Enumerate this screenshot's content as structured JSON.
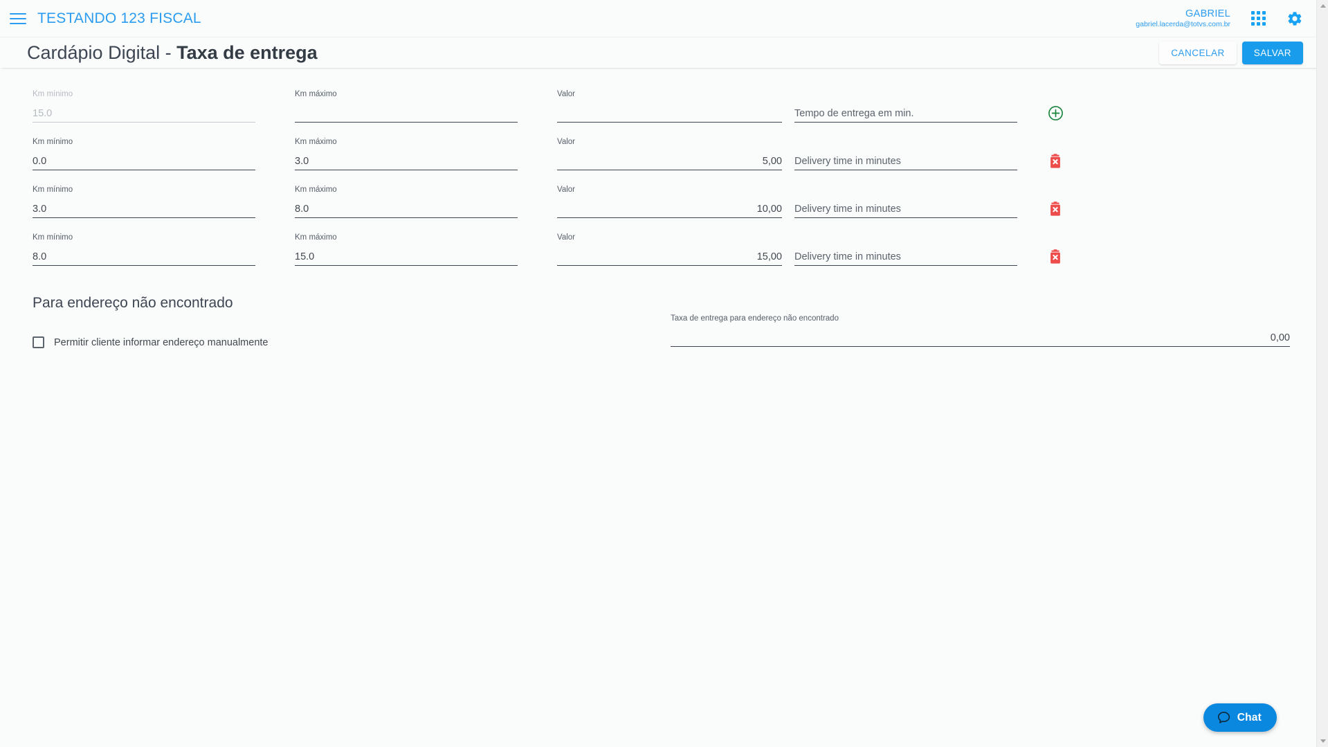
{
  "appbar": {
    "menu_icon": "hamburger-menu-icon",
    "brand": "TESTANDO 123 FISCAL",
    "user_name": "GABRIEL",
    "user_email": "gabriel.lacerda@totvs.com.br",
    "apps_icon": "apps-grid-icon",
    "settings_icon": "gear-icon",
    "accent_color": "#2b9cf0"
  },
  "titlebar": {
    "title_prefix": "Cardápio Digital",
    "title_separator": " - ",
    "title_main": "Taxa de entrega",
    "cancel_label": "CANCELAR",
    "save_label": "SALVAR",
    "save_color": "#199ceb"
  },
  "table": {
    "labels": {
      "km_min": "Km mínimo",
      "km_max": "Km máximo",
      "valor": "Valor"
    },
    "placeholders": {
      "tempo_new": "Tempo de entrega em min.",
      "tempo_existing": "Delivery time in minutes"
    },
    "rows": [
      {
        "km_min": "15.0",
        "km_min_label": "Km mínimo",
        "km_min_disabled": true,
        "km_max": "",
        "km_max_label": "Km máximo",
        "valor": "",
        "valor_label": "Valor",
        "tempo": "",
        "tempo_placeholder": "Tempo de entrega em min.",
        "action": "add",
        "action_icon": "add-circle-icon",
        "action_color": "#17823a"
      },
      {
        "km_min": "0.0",
        "km_min_label": "Km mínimo",
        "km_min_disabled": false,
        "km_max": "3.0",
        "km_max_label": "Km máximo",
        "valor": "5,00",
        "valor_label": "Valor",
        "tempo": "",
        "tempo_placeholder": "Delivery time in minutes",
        "action": "delete",
        "action_icon": "delete-trash-icon",
        "action_color": "#ee4b4b"
      },
      {
        "km_min": "3.0",
        "km_min_label": "Km mínimo",
        "km_min_disabled": false,
        "km_max": "8.0",
        "km_max_label": "Km máximo",
        "valor": "10,00",
        "valor_label": "Valor",
        "tempo": "",
        "tempo_placeholder": "Delivery time in minutes",
        "action": "delete",
        "action_icon": "delete-trash-icon",
        "action_color": "#ee4b4b"
      },
      {
        "km_min": "8.0",
        "km_min_label": "Km mínimo",
        "km_min_disabled": false,
        "km_max": "15.0",
        "km_max_label": "Km máximo",
        "valor": "15,00",
        "valor_label": "Valor",
        "tempo": "",
        "tempo_placeholder": "Delivery time in minutes",
        "action": "delete",
        "action_icon": "delete-trash-icon",
        "action_color": "#ee4b4b"
      }
    ]
  },
  "not_found_section": {
    "heading": "Para endereço não encontrado",
    "checkbox_label": "Permitir cliente informar endereço manualmente",
    "checkbox_checked": false,
    "fee_label": "Taxa de entrega para endereço não encontrado",
    "fee_value": "0,00"
  },
  "chat": {
    "label": "Chat",
    "icon": "chat-bubble-icon",
    "color": "#0a87df"
  },
  "scrollbar": {
    "up_icon": "scroll-up-arrow-icon",
    "down_icon": "scroll-down-arrow-icon"
  }
}
